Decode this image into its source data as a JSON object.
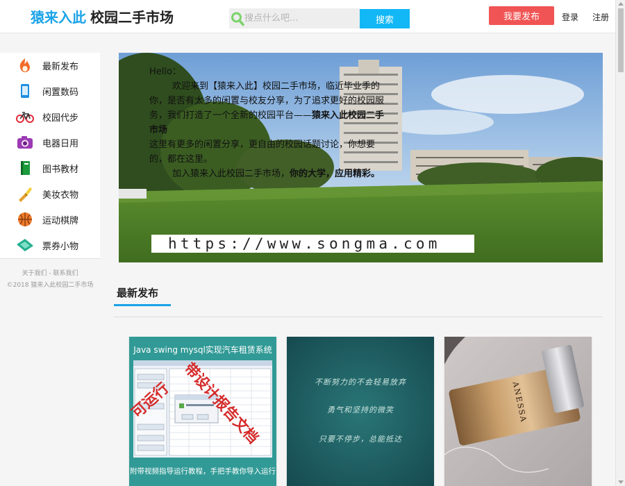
{
  "header": {
    "logo_brand": "猿来入此",
    "logo_rest": "校园二手市场",
    "search_placeholder": "搜点什么吧...",
    "search_button": "搜索",
    "publish_button": "我要发布",
    "login": "登录",
    "register": "注册"
  },
  "sidebar": {
    "items": [
      {
        "label": "最新发布",
        "icon": "flame-icon"
      },
      {
        "label": "闲置数码",
        "icon": "phone-icon"
      },
      {
        "label": "校园代步",
        "icon": "bicycle-icon"
      },
      {
        "label": "电器日用",
        "icon": "camera-icon"
      },
      {
        "label": "图书教材",
        "icon": "book-icon"
      },
      {
        "label": "美妆衣物",
        "icon": "brush-icon"
      },
      {
        "label": "运动棋牌",
        "icon": "basketball-icon"
      },
      {
        "label": "票券小物",
        "icon": "ticket-icon"
      }
    ],
    "footer_links": "关于我们 - 联系我们",
    "footer_copyright": "©2018 猿来入此校园二手市场"
  },
  "banner": {
    "greeting": "Hello：",
    "line1": "欢迎来到【猿来入此】校园二手市场，临近毕业季的",
    "line2": "你，是否有太多的闲置与校友分享，为了追求更好的校园服",
    "line3a": "务，我们打造了一个全新的校园平台——",
    "line3b": "猿来入此校园二手",
    "line4": "市场",
    "line5": "这里有更多的闲置分享，更自由的校园话题讨论，你想要",
    "line6": "的，都在这里。",
    "line7a": "加入猿来入此校园二手市场，",
    "line7b": "你的大学，应用精彩。",
    "watermark": "https://www.songma.com"
  },
  "latest": {
    "title": "最新发布"
  },
  "cards": [
    {
      "header": "Java swing mysql实现汽车租赁系统",
      "stamp_a": "可运行",
      "stamp_b": "带设计报告文档",
      "footer": "附带视频指导运行教程，手把手教你导入运行"
    },
    {
      "lines": [
        "不断努力的不会轻易放弃",
        "勇气和坚持的微笑",
        "只要不停步，总能抵达"
      ]
    },
    {
      "brand": "ANESSA"
    }
  ],
  "colors": {
    "brand_blue": "#1aa3e8",
    "search_button": "#12b7f5",
    "publish_red": "#f05454",
    "card1_teal": "#319a96",
    "card2_teal": "#1d5a5e"
  }
}
